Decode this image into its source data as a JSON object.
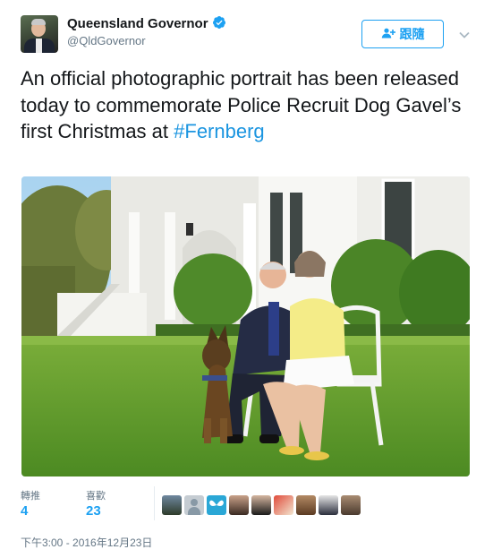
{
  "author": {
    "display_name": "Queensland Governor",
    "handle": "@QldGovernor",
    "verified": true
  },
  "follow_button": {
    "label": "跟隨",
    "icon": "add-user-icon"
  },
  "menu": {
    "icon": "chevron-down-icon"
  },
  "tweet": {
    "text": "An official photographic portrait has been released today to commemorate Police Recruit Dog Gavel’s first Christmas at ",
    "hashtag": "#Fernberg"
  },
  "stats": {
    "retweets_label": "轉推",
    "retweets_count": "4",
    "likes_label": "喜歡",
    "likes_count": "23"
  },
  "timestamp": "下午3:00 - 2016年12月23日",
  "colors": {
    "accent": "#1da1f2",
    "hashtag": "#1b95e0",
    "muted": "#657786",
    "text": "#14171a"
  }
}
